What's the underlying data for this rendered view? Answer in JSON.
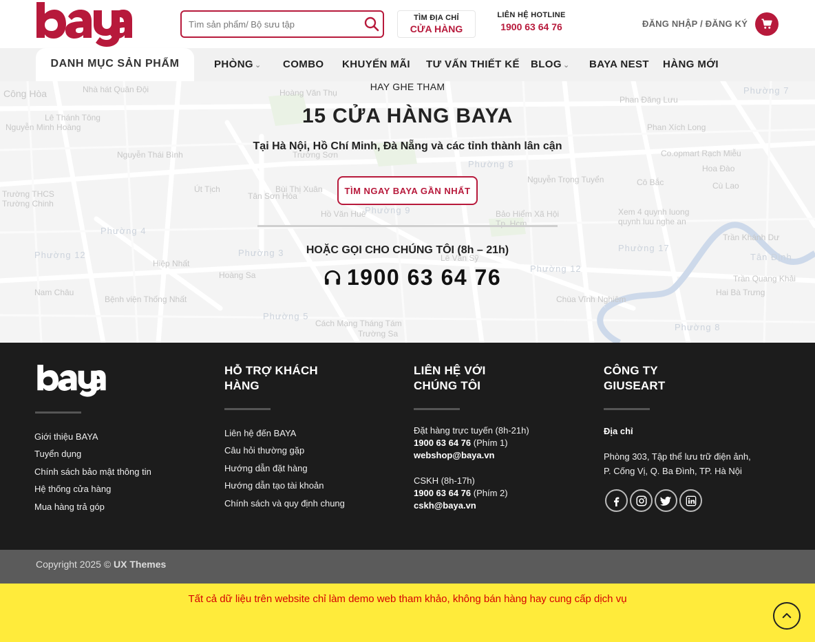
{
  "header": {
    "logo_text": "baya",
    "search": {
      "placeholder": "Tìm sản phẩm/ Bộ sưu tập",
      "value": ""
    },
    "store_finder": {
      "line1": "TÌM ĐỊA CHỈ",
      "line2": "CỬA HÀNG"
    },
    "hotline": {
      "label": "LIÊN HỆ HOTLINE",
      "number": "1900 63 64 76"
    },
    "login": "ĐĂNG NHẬP / ĐĂNG KÝ",
    "cart_icon": "cart-icon"
  },
  "nav": {
    "category_tab": "DANH MỤC SẢN PHẨM",
    "items": [
      {
        "label": "PHÒNG",
        "has_dropdown": true
      },
      {
        "label": "COMBO",
        "has_dropdown": false
      },
      {
        "label": "KHUYẾN MÃI",
        "has_dropdown": false
      },
      {
        "label": "TƯ VẤN THIẾT KẾ",
        "has_dropdown": false
      },
      {
        "label": "BLOG",
        "has_dropdown": true
      },
      {
        "label": "BAYA NEST",
        "has_dropdown": false
      },
      {
        "label": "HÀNG MỚI",
        "has_dropdown": false
      }
    ]
  },
  "map": {
    "labels": [
      "Công Hòa",
      "Nhà hát Quân Đội",
      "Hoàng Văn Thụ",
      "Lê Thánh Tông",
      "Nguyễn Minh Hoàng",
      "Trường THCS Trường Chinh",
      "Phường 4",
      "Phường 12",
      "Phường 3",
      "Phường 5",
      "Bệnh viện Thống Nhất",
      "Hiệp Nhất",
      "Nam Châu",
      "Hoàng Sa",
      "Trường Sa",
      "Cách Mạng Tháng Tám",
      "Phường 8",
      "Phường 7",
      "Phan Đăng Lưu",
      "Phan Xích Long",
      "Co.opmart Rạch Miễu",
      "Hoa Đào",
      "Cù Lao",
      "Cô Bắc",
      "Trần Quang Khải",
      "Tân Định",
      "Trần Khánh Dư",
      "Phường 17",
      "Phường 12",
      "Chùa Vĩnh Nghiêm",
      "Bảo Hiểm Xã Hội Tp. Hcm",
      "Xem 4 quynh luong quynh luu nghe an",
      "Hai Bà Trưng",
      "Phường 9",
      "Phường 8",
      "Nguyễn Trọng Tuyển",
      "Trường Sơn",
      "Lê Văn Sỹ",
      "Út Tịch",
      "Tân Sơn Hòa",
      "Hồ Văn Huê",
      "Nguyễn Thái Bình",
      "Bùi Thị Xuân"
    ],
    "small_heading": "HAY GHE THAM",
    "title": "15 CỬA HÀNG BAYA",
    "subtitle": "Tại Hà Nội, Hồ Chí Minh, Đà Nẵng và các tỉnh thành lân cận",
    "find_button": "TÌM NGAY BAYA GẦN NHẤT",
    "call_heading": "HOẶC GỌI CHO CHÚNG TÔI (8h – 21h)",
    "phone": "1900 63 64 76"
  },
  "footer": {
    "logo_text": "baya",
    "about_links": [
      "Giới thiệu BAYA",
      "Tuyển dụng",
      "Chính sách bảo mật thông tin",
      "Hệ thống cửa hàng",
      "Mua hàng trả góp"
    ],
    "support": {
      "heading_line1": "HỖ TRỢ KHÁCH",
      "heading_line2": "HÀNG",
      "links": [
        "Liên hệ đến BAYA",
        "Câu hỏi thường gặp",
        "Hướng dẫn đặt hàng",
        "Hướng dẫn tạo tài khoản",
        "Chính sách và quy định chung"
      ]
    },
    "contact": {
      "heading_line1": "LIÊN HỆ VỚI",
      "heading_line2": "CHÚNG TÔI",
      "online_label": "Đặt hàng trực tuyến (8h-21h)",
      "online_phone": "1900 63 64 76",
      "online_ext": "(Phím 1)",
      "online_email": "webshop@baya.vn",
      "cs_label": "CSKH (8h-17h)",
      "cs_phone": "1900 63 64 76",
      "cs_ext": "(Phím 2)",
      "cs_email": "cskh@baya.vn"
    },
    "company": {
      "heading_line1": "CÔNG TY",
      "heading_line2": "GIUSEART",
      "address_label": "Địa chỉ",
      "address_line1": "Phòng 303, Tập thể lưu trữ điện ảnh,",
      "address_line2": "P. Cống Vị, Q. Ba Đình, TP. Hà Nội",
      "social": [
        "facebook-icon",
        "instagram-icon",
        "twitter-icon",
        "linkedin-icon"
      ]
    }
  },
  "copyright": {
    "prefix": "Copyright 2025 ©",
    "brand": "UX Themes"
  },
  "notice": "Tất cả dữ liệu trên website chỉ làm demo web tham khảo, không bán hàng hay cung cấp dịch vụ",
  "colors": {
    "brand": "#b7193b",
    "footer_bg": "#1c1c1c",
    "copy_bg": "#5b5b5b",
    "notice_bg": "#ffeb3b",
    "notice_text": "#d50000"
  }
}
